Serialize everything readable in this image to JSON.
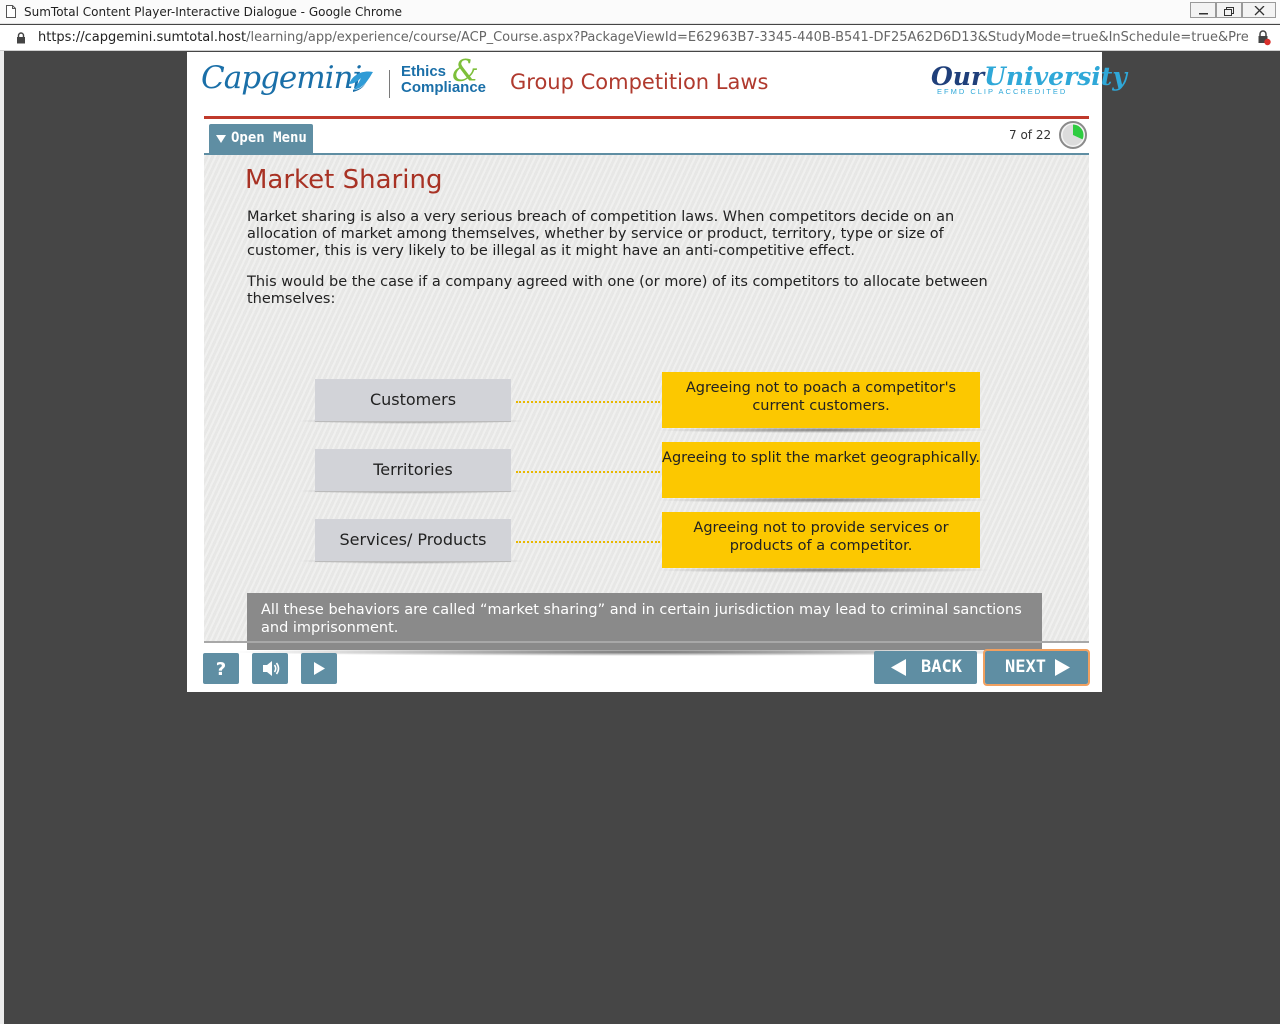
{
  "window": {
    "title": "SumTotal Content Player-Interactive Dialogue - Google Chrome",
    "url_host": "https://capgemini.sumtotal.host",
    "url_path": "/learning/app/experience/course/ACP_Course.aspx?PackageViewId=E62963B7-3345-440B-B541-DF25A62D6D13&StudyMode=true&InSchedule=true&Preview=..."
  },
  "header": {
    "brand": "Capgemini",
    "ethics_line1": "Ethics",
    "ethics_line2": "Compliance",
    "ampersand": "&",
    "course_title": "Group Competition Laws",
    "ou_part1": "Our",
    "ou_part2": "University",
    "ou_sub": "EFMD CLIP ACCREDITED"
  },
  "menu": {
    "open_menu_label": "Open Menu",
    "page_counter": "7 of 22",
    "progress_fraction": 0.3182
  },
  "slide": {
    "title": "Market Sharing",
    "para1": "Market sharing is also a very serious breach of competition laws. When competitors decide on an allocation of market among themselves, whether by service or product, territory, type or size of customer, this is very likely to be illegal as it might have an anti-competitive effect.",
    "para2": "This would be the case if a company agreed with one (or more) of its competitors to allocate between themselves:",
    "items": [
      {
        "label": "Customers",
        "description": "Agreeing not to poach a competitor's current customers."
      },
      {
        "label": "Territories",
        "description": "Agreeing to split the market geographically."
      },
      {
        "label": "Services/ Products",
        "description": "Agreeing not to provide services or products of a competitor."
      }
    ],
    "summary": "All these behaviors are called “market sharing” and in certain jurisdiction may lead to criminal sanctions and imprisonment."
  },
  "controls": {
    "help_label": "?",
    "back_label": "BACK",
    "next_label": "NEXT",
    "icons": [
      "help-icon",
      "audio-icon",
      "play-icon"
    ]
  },
  "colors": {
    "accent_blue": "#5f8ea3",
    "title_red": "#a83224",
    "highlight_yellow": "#fcc800",
    "progress_green": "#2ecc40"
  }
}
